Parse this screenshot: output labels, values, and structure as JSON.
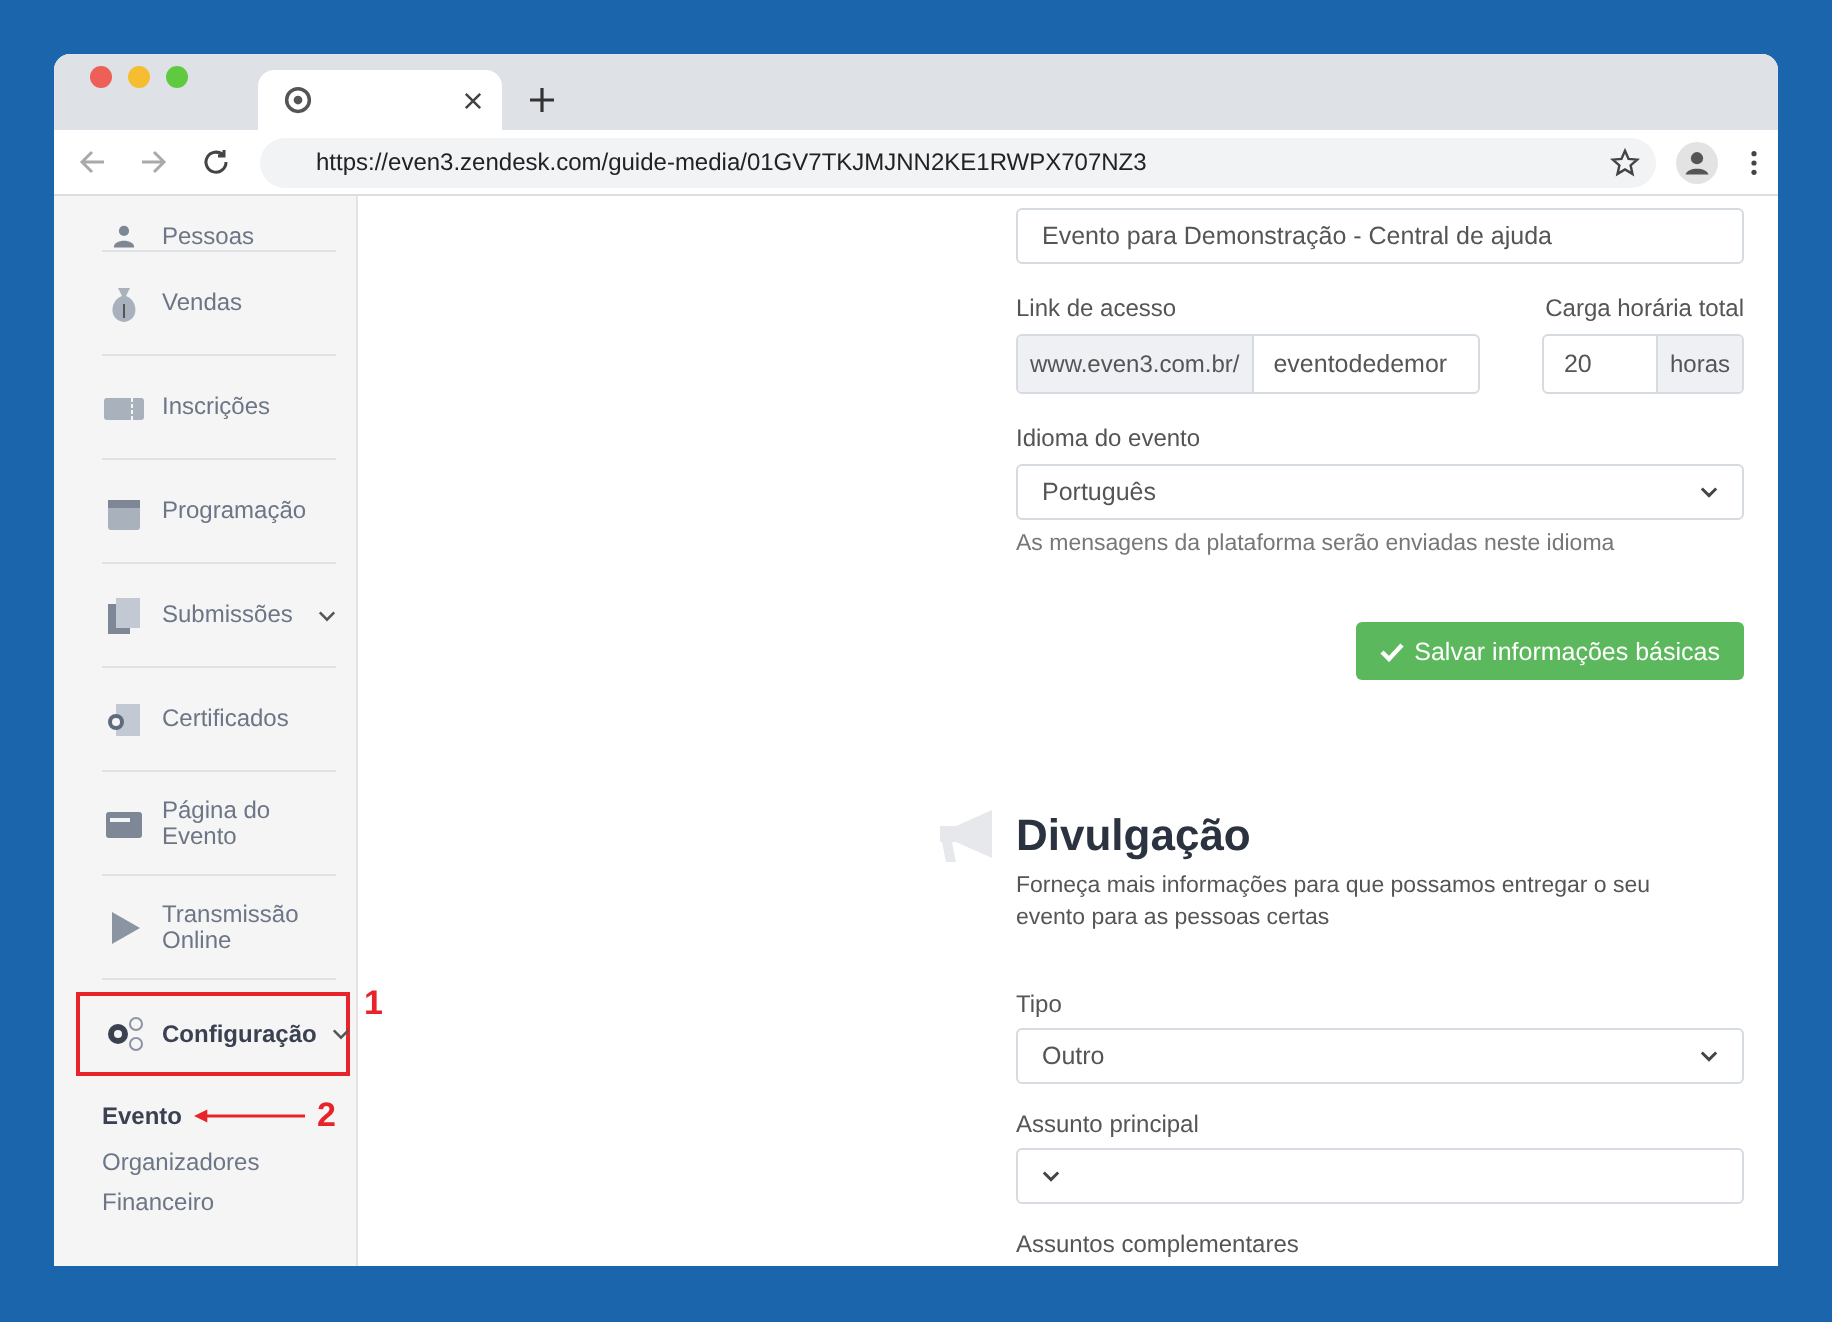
{
  "browser": {
    "url": "https://even3.zendesk.com/guide-media/01GV7TKJMJNN2KE1RWPX707NZ3"
  },
  "sidebar": {
    "items": [
      {
        "label": "Pessoas",
        "expandable": false,
        "selected": false
      },
      {
        "label": "Vendas",
        "expandable": false,
        "selected": false
      },
      {
        "label": "Inscrições",
        "expandable": false,
        "selected": false
      },
      {
        "label": "Programação",
        "expandable": false,
        "selected": false
      },
      {
        "label": "Submissões",
        "expandable": true,
        "selected": false
      },
      {
        "label": "Certificados",
        "expandable": false,
        "selected": false
      },
      {
        "label": "Página do Evento",
        "expandable": false,
        "selected": false
      },
      {
        "label": "Transmissão Online",
        "expandable": false,
        "selected": false
      },
      {
        "label": "Configuração",
        "expandable": true,
        "selected": true
      }
    ],
    "submenu": [
      {
        "label": "Evento",
        "selected": true
      },
      {
        "label": "Organizadores",
        "selected": false
      },
      {
        "label": "Financeiro",
        "selected": false
      }
    ]
  },
  "basic_info": {
    "event_name": "Evento para Demonstração - Central de ajuda",
    "link_label": "Link de acesso",
    "link_prefix": "www.even3.com.br/",
    "link_value": "eventodedemor",
    "hours_label": "Carga horária total",
    "hours_value": "20",
    "hours_unit": "horas",
    "language_label": "Idioma do evento",
    "language_value": "Português",
    "language_hint": "As mensagens da plataforma serão enviadas neste idioma",
    "save_button": "Salvar informações básicas"
  },
  "promotion": {
    "title": "Divulgação",
    "description": "Forneça mais informações para que possamos entregar o seu evento para as pessoas certas",
    "type_label": "Tipo",
    "type_value": "Outro",
    "subject_label": "Assunto principal",
    "more_label": "Assuntos complementares"
  },
  "annotations": [
    {
      "label": "1"
    },
    {
      "label": "2"
    }
  ]
}
